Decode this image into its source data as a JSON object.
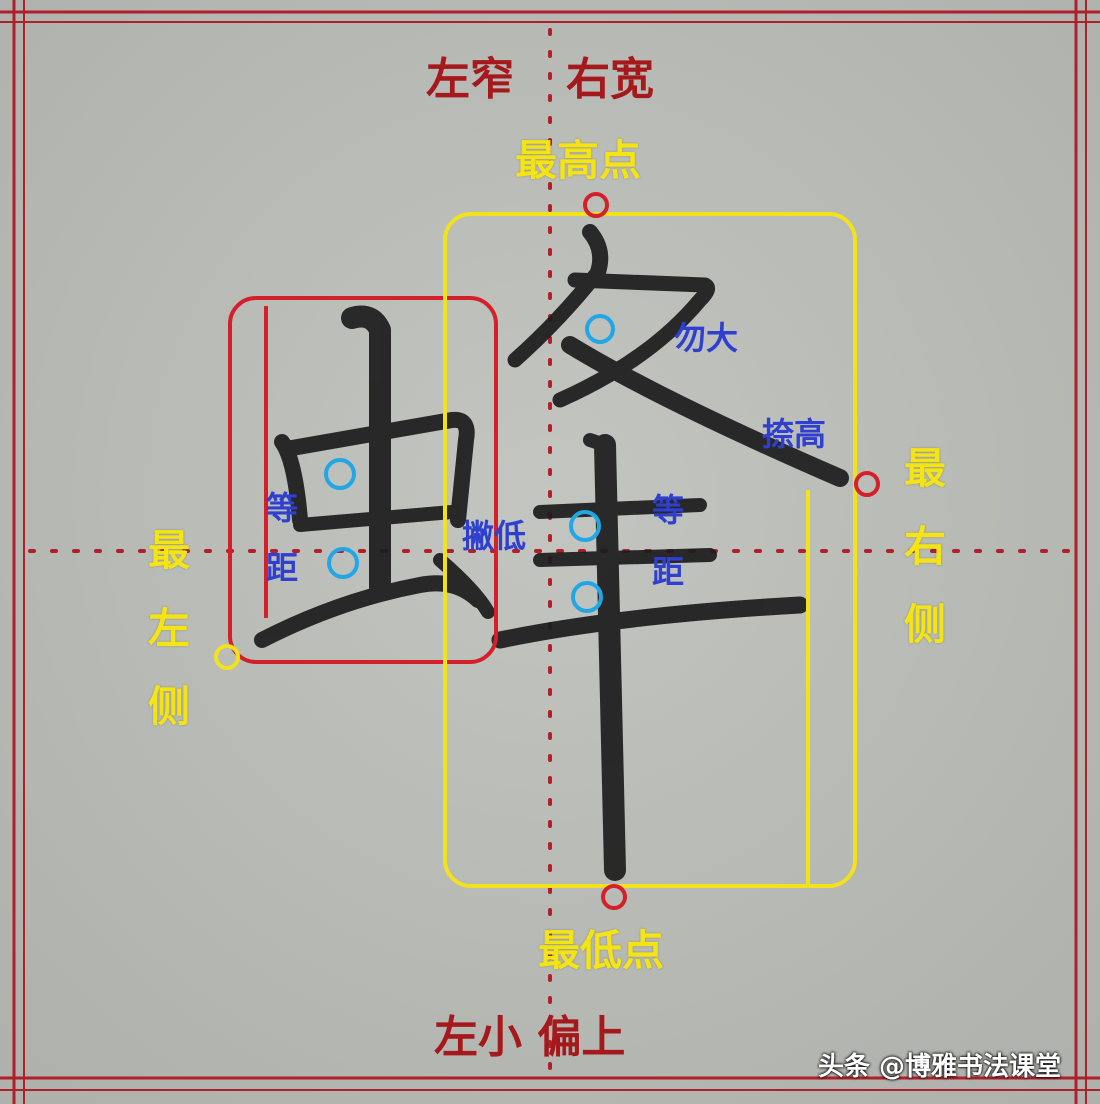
{
  "labels": {
    "top_title_left": "左窄",
    "top_title_right": "右宽",
    "highest_point": "最高点",
    "lowest_point": "最低点",
    "bottom_title": "左小 偏上",
    "left_side": [
      "最",
      "左",
      "侧"
    ],
    "right_side": [
      "最",
      "右",
      "侧"
    ],
    "wu_da": "勿大",
    "na_gao": "捺高",
    "pie_di": "撇低",
    "equal_left": [
      "等",
      "距"
    ],
    "equal_right": [
      "等",
      "距"
    ]
  },
  "watermark": "头条 @博雅书法课堂",
  "character": "蜂",
  "colors": {
    "paper": "#b9bbb6",
    "grid_red": "#b0202a",
    "box_red": "#d4202a",
    "box_yellow": "#f2e21c",
    "label_yellow": "#f5e414",
    "label_blue": "#2f3fd0",
    "circle_blue": "#21a7e6",
    "ink": "#1c1c1c"
  }
}
